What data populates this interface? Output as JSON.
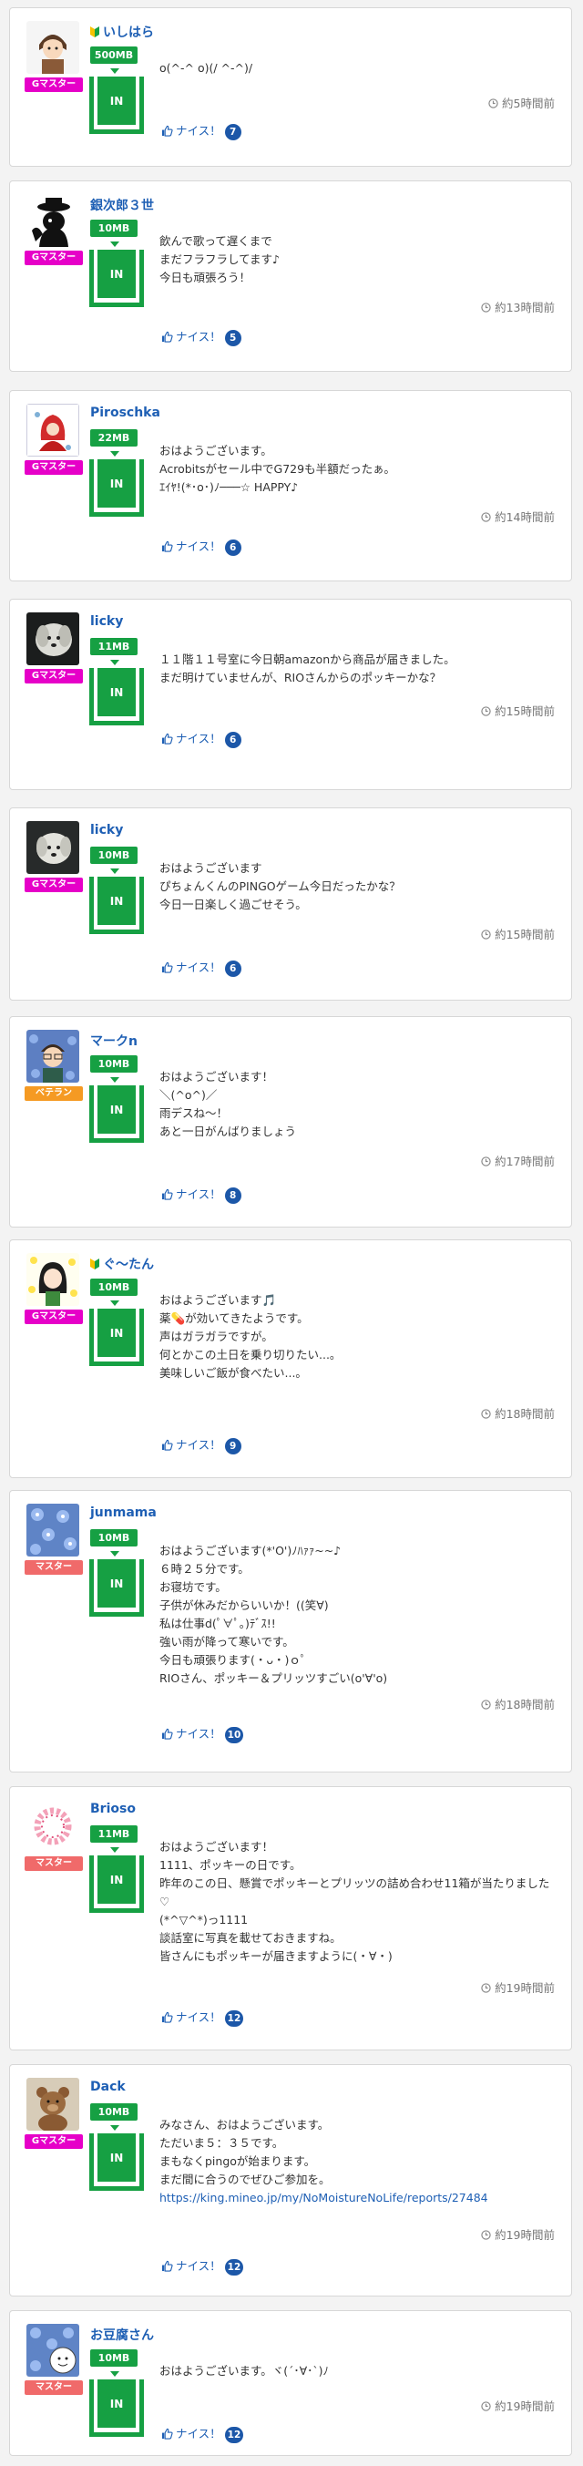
{
  "page": {
    "icon_clock": "clock-icon",
    "icon_thumb": "thumbs-up-icon"
  },
  "colors": {
    "master": "#e600c8",
    "master_pink": "#f06a6a",
    "veteran": "#f59a23",
    "accent_green": "#16a043",
    "link_blue": "#1e5fb4"
  },
  "posts": [
    {
      "user": "いしはら",
      "beginner": true,
      "rank": "Gマスター",
      "mb": "500MB",
      "inbox": "IN",
      "lines": [
        "o(^-^ o)(/ ^-^)/"
      ],
      "time": "約5時間前",
      "nice_label": "ナイス！",
      "nice_count": "7"
    },
    {
      "user": "銀次郎３世",
      "beginner": false,
      "rank": "Gマスター",
      "mb": "10MB",
      "inbox": "IN",
      "lines": [
        "飲んで歌って遅くまで",
        "まだフラフラしてます♪",
        "今日も頑張ろう！"
      ],
      "time": "約13時間前",
      "nice_label": "ナイス！",
      "nice_count": "5"
    },
    {
      "user": "Piroschka",
      "beginner": false,
      "rank": "Gマスター",
      "mb": "22MB",
      "inbox": "IN",
      "lines": [
        "おはようございます。",
        "Acrobitsがセール中でG729も半額だったぁ。",
        "ｴｲﾔ!(*･o･)ﾉ───☆ HAPPY♪"
      ],
      "time": "約14時間前",
      "nice_label": "ナイス！",
      "nice_count": "6"
    },
    {
      "user": "licky",
      "beginner": false,
      "rank": "Gマスター",
      "mb": "11MB",
      "inbox": "IN",
      "lines": [
        "１１階１１号室に今日朝amazonから商品が届きました。",
        "まだ明けていませんが、RIOさんからのポッキーかな？"
      ],
      "time": "約15時間前",
      "nice_label": "ナイス！",
      "nice_count": "6"
    },
    {
      "user": "licky",
      "beginner": false,
      "rank": "Gマスター",
      "mb": "10MB",
      "inbox": "IN",
      "lines": [
        "おはようございます",
        "ぴちょんくんのPINGOゲーム今日だったかな？",
        "今日一日楽しく過ごせそう。"
      ],
      "time": "約15時間前",
      "nice_label": "ナイス！",
      "nice_count": "6"
    },
    {
      "user": "マークn",
      "beginner": false,
      "rank": "ベテラン",
      "mb": "10MB",
      "inbox": "IN",
      "lines": [
        "おはようございます！",
        "＼(^o^)／",
        "雨デスね〜！",
        "あと一日がんばりましょう"
      ],
      "time": "約17時間前",
      "nice_label": "ナイス！",
      "nice_count": "8"
    },
    {
      "user": "ぐ〜たん",
      "beginner": true,
      "rank": "Gマスター",
      "mb": "10MB",
      "inbox": "IN",
      "lines": [
        "おはようございます🎵",
        "薬💊が効いてきたようです。",
        "声はガラガラですが。",
        "何とかこの土日を乗り切りたい...。",
        "美味しいご飯が食べたい...。"
      ],
      "time": "約18時間前",
      "nice_label": "ナイス！",
      "nice_count": "9"
    },
    {
      "user": "junmama",
      "beginner": false,
      "rank": "マスター",
      "mb": "10MB",
      "inbox": "IN",
      "lines": [
        "おはようございます(*'O')ﾉﾊｧｧ~~♪",
        "６時２５分です。",
        "お寝坊です。",
        "子供が休みだからいいか！((笑∀)",
        "私は仕事d(ﾟ∀ﾟ｡)ﾃﾞｽ!!",
        "強い雨が降って寒いです。",
        "今日も頑張ります(・ᴗ・)ｏﾟ",
        "RIOさん、ポッキー＆プリッツすごい(o'∀'o)"
      ],
      "time": "約18時間前",
      "nice_label": "ナイス！",
      "nice_count": "10"
    },
    {
      "user": "Brioso",
      "beginner": false,
      "rank": "マスター",
      "mb": "11MB",
      "inbox": "IN",
      "lines": [
        "おはようございます！",
        "1111、ポッキーの日です。",
        "昨年のこの日、懸賞でポッキーとプリッツの詰め合わせ11箱が当たりました♡",
        "(*^▽^*)っ1111",
        "談話室に写真を載せておきますね。",
        "皆さんにもポッキーが届きますように(・∀・)"
      ],
      "time": "約19時間前",
      "nice_label": "ナイス！",
      "nice_count": "12"
    },
    {
      "user": "Dack",
      "beginner": false,
      "rank": "Gマスター",
      "mb": "10MB",
      "inbox": "IN",
      "lines": [
        "みなさん、おはようございます。",
        "ただいま５：３５です。",
        "まもなくpingoが始まります。",
        "まだ間に合うのでぜひご参加を。",
        "https://king.mineo.jp/my/NoMoistureNoLife/reports/27484"
      ],
      "time": "約19時間前",
      "nice_label": "ナイス！",
      "nice_count": "12"
    },
    {
      "user": "お豆腐さん",
      "beginner": false,
      "rank": "マスター",
      "mb": "10MB",
      "inbox": "IN",
      "lines": [
        "おはようございます。ヾ(´･∀･`)ﾉ"
      ],
      "time": "約19時間前",
      "nice_label": "ナイス！",
      "nice_count": "12"
    }
  ]
}
